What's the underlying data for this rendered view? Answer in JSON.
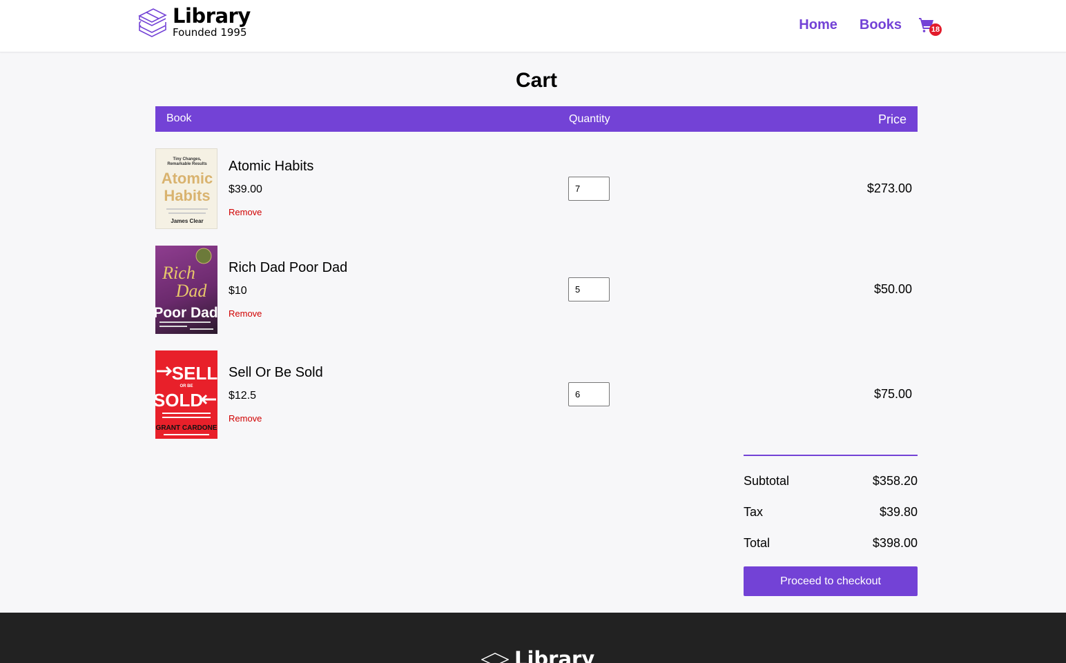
{
  "header": {
    "logo_title": "Library",
    "logo_subtitle": "Founded 1995",
    "nav": [
      {
        "label": "Home"
      },
      {
        "label": "Books"
      }
    ],
    "cart_count": "18"
  },
  "page_title": "Cart",
  "table": {
    "columns": [
      "Book",
      "Quantity",
      "Price"
    ]
  },
  "items": [
    {
      "title": "Atomic Habits",
      "unit_price": "$39.00",
      "remove_label": "Remove",
      "quantity": "7",
      "line_total": "$273.00",
      "cover": {
        "line1": "Tiny Changes,",
        "line2": "Remarkable Results",
        "word1": "Atomic",
        "word2": "Habits",
        "author": "James Clear"
      }
    },
    {
      "title": "Rich Dad Poor Dad",
      "unit_price": "$10",
      "remove_label": "Remove",
      "quantity": "5",
      "line_total": "$50.00",
      "cover": {
        "word1": "Rich",
        "word2": "Dad",
        "word3": "Poor Dad"
      }
    },
    {
      "title": "Sell Or Be Sold",
      "unit_price": "$12.5",
      "remove_label": "Remove",
      "quantity": "6",
      "line_total": "$75.00",
      "cover": {
        "word1": "SELL",
        "word2": "OR BE",
        "word3": "SOLD",
        "author": "GRANT CARDONE"
      }
    }
  ],
  "summary": {
    "subtotal_label": "Subtotal",
    "subtotal": "$358.20",
    "tax_label": "Tax",
    "tax": "$39.80",
    "total_label": "Total",
    "total": "$398.00"
  },
  "checkout_label": "Proceed to checkout",
  "footer": {
    "logo_title": "Library"
  },
  "colors": {
    "accent": "#7342d6",
    "danger": "#d00000",
    "badge": "#e21b2b",
    "footer": "#222222"
  }
}
